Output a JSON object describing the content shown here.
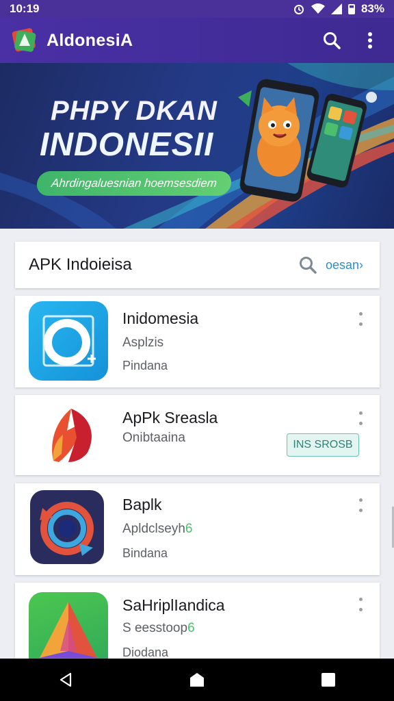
{
  "status": {
    "time": "10:19",
    "battery_text": "83%"
  },
  "appbar": {
    "title": "AldonesiA",
    "search_icon": "search-icon",
    "menu_icon": "more-vert-icon"
  },
  "banner": {
    "title_line1": "PHPY DKAN",
    "title_line2": "INDONESII",
    "pill_text": "Ahrdingaluesnian hoemsesdiem"
  },
  "search": {
    "label": "APK Indoieisa",
    "link": "oesan›"
  },
  "apps": [
    {
      "name": "Inidomesia",
      "sub": "Asplzis",
      "category": "Pindana"
    },
    {
      "name": "ApPk Sreasla",
      "sub": "Onibtaaina",
      "category": "",
      "install_label": "INS SROSB"
    },
    {
      "name": "Baplk",
      "sub": "Apldclseyh",
      "sub_accent": "6",
      "category": "Bindana"
    },
    {
      "name": "SaHriplIandica",
      "sub": "S eesstoop",
      "sub_accent": "6",
      "category": "Diodana"
    }
  ],
  "nav": {
    "back": "back-icon",
    "home": "home-icon",
    "recents": "recents-icon"
  },
  "colors": {
    "primary": "#4a3099",
    "accent_green": "#4cbf6d",
    "link_blue": "#2c8fc7"
  }
}
